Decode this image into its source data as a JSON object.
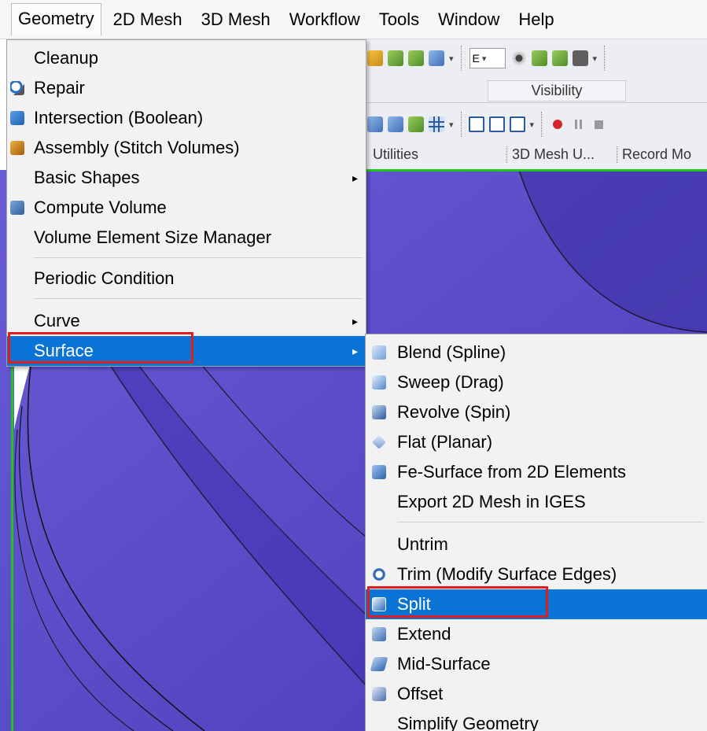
{
  "menubar": {
    "items": [
      {
        "id": "geometry",
        "label": "Geometry",
        "active": true
      },
      {
        "id": "2d-mesh",
        "label": "2D Mesh"
      },
      {
        "id": "3d-mesh",
        "label": "3D Mesh"
      },
      {
        "id": "workflow",
        "label": "Workflow"
      },
      {
        "id": "tools",
        "label": "Tools"
      },
      {
        "id": "window",
        "label": "Window"
      },
      {
        "id": "help",
        "label": "Help"
      }
    ]
  },
  "toolbar": {
    "combo_value": "E",
    "group_visibility": "Visibility",
    "group_utilities": "Utilities",
    "group_3d_mesh_utilities": "3D Mesh U...",
    "group_record": "Record Mo"
  },
  "geometry_menu": {
    "items": [
      {
        "label": "Cleanup",
        "icon": "none"
      },
      {
        "label": "Repair",
        "icon": "repair-icon"
      },
      {
        "label": "Intersection (Boolean)",
        "icon": "boolean-icon"
      },
      {
        "label": "Assembly (Stitch Volumes)",
        "icon": "assembly-icon"
      },
      {
        "label": "Basic Shapes",
        "icon": "none",
        "submenu": true
      },
      {
        "label": "Compute Volume",
        "icon": "compute-volume-icon"
      },
      {
        "label": "Volume Element Size Manager",
        "icon": "none"
      },
      {
        "label": "Periodic Condition",
        "icon": "none"
      },
      {
        "label": "Curve",
        "icon": "none",
        "submenu": true
      },
      {
        "label": "Surface",
        "icon": "none",
        "submenu": true,
        "highlighted": true
      }
    ]
  },
  "surface_menu": {
    "items": [
      {
        "label": "Blend (Spline)",
        "icon": "blend-icon"
      },
      {
        "label": "Sweep (Drag)",
        "icon": "sweep-icon"
      },
      {
        "label": "Revolve (Spin)",
        "icon": "revolve-icon"
      },
      {
        "label": "Flat (Planar)",
        "icon": "flat-icon"
      },
      {
        "label": "Fe-Surface from 2D Elements",
        "icon": "fe-surface-icon"
      },
      {
        "label": "Export 2D Mesh in IGES",
        "icon": "none"
      },
      {
        "label": "Untrim",
        "icon": "none"
      },
      {
        "label": "Trim (Modify Surface Edges)",
        "icon": "trim-icon"
      },
      {
        "label": "Split",
        "icon": "split-icon",
        "highlighted": true
      },
      {
        "label": "Extend",
        "icon": "extend-icon"
      },
      {
        "label": "Mid-Surface",
        "icon": "mid-surface-icon"
      },
      {
        "label": "Offset",
        "icon": "offset-icon"
      },
      {
        "label": "Simplify Geometry",
        "icon": "none"
      }
    ]
  },
  "colors": {
    "highlight": "#0a73d6",
    "annotation_box": "#e01c1c",
    "viewport_surface": "#5a4acb"
  }
}
